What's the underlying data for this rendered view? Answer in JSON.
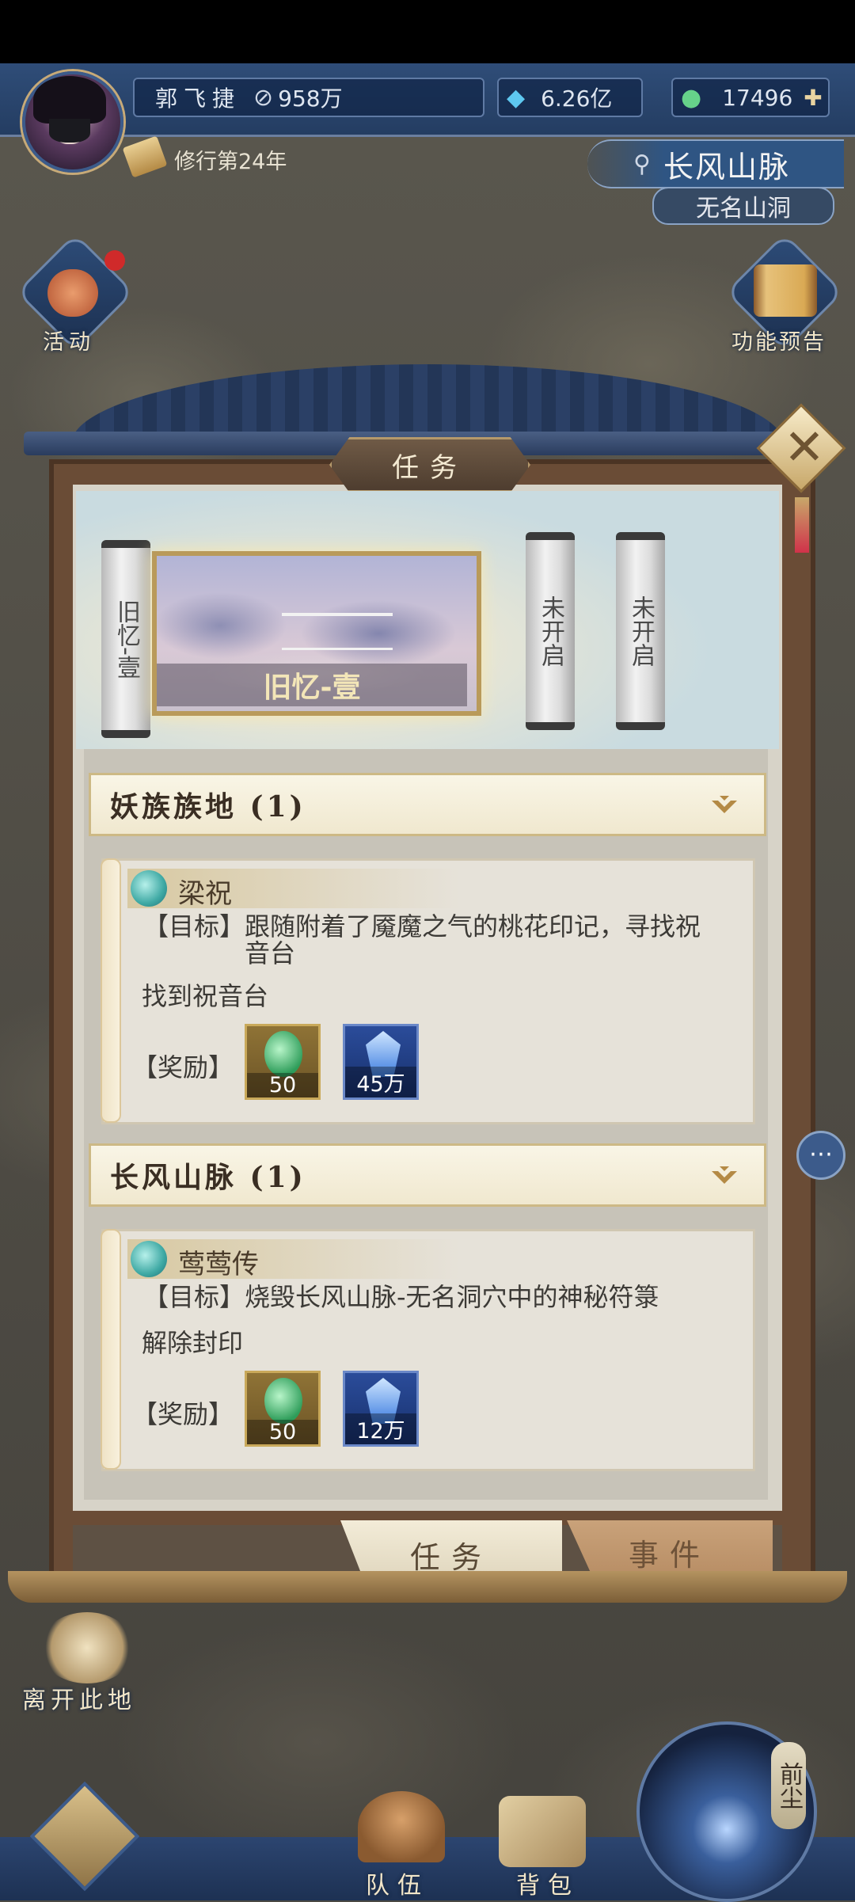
{
  "player": {
    "name": "郭飞捷",
    "power": "958万",
    "spirit_stones": "6.26亿",
    "jade": "17496",
    "cultivation_years": "修行第24年"
  },
  "location": {
    "region": "长风山脉",
    "spot": "无名山洞"
  },
  "side_buttons": {
    "activity": "活动",
    "preview": "功能预告"
  },
  "panel": {
    "title": "任务",
    "chapters": [
      {
        "label": "旧忆-壹",
        "active": true
      },
      {
        "label": "未开启",
        "active": false
      },
      {
        "label": "未开启",
        "active": false
      }
    ],
    "current_chapter_label": "旧忆-壹",
    "categories": [
      {
        "title": "妖族族地 (1)",
        "quest": {
          "name": "梁祝",
          "goal_line1": "【目标】跟随附着了魇魔之气的桃花印记，寻找祝",
          "goal_line2": "音台",
          "step": "找到祝音台",
          "reward_label": "【奖励】",
          "rewards": [
            {
              "icon": "jade-icon",
              "qty": "50"
            },
            {
              "icon": "crystal-icon",
              "qty": "45万"
            }
          ]
        }
      },
      {
        "title": "长风山脉 (1)",
        "quest": {
          "name": "莺莺传",
          "goal_line1": "【目标】烧毁长风山脉-无名洞穴中的神秘符箓",
          "step": "解除封印",
          "reward_label": "【奖励】",
          "rewards": [
            {
              "icon": "jade-icon",
              "qty": "50"
            },
            {
              "icon": "crystal-icon",
              "qty": "12万"
            }
          ]
        }
      }
    ],
    "tabs": {
      "task": "任务",
      "event": "事件"
    }
  },
  "bottom": {
    "leave": "离开此地",
    "team": "队伍",
    "bag": "背包",
    "past": "前尘"
  },
  "colors": {
    "hud_blue": "#2f4d78",
    "frame_brown": "#6a4c36",
    "parchment": "#e6e2d9",
    "accent_gold": "#cdb985"
  }
}
